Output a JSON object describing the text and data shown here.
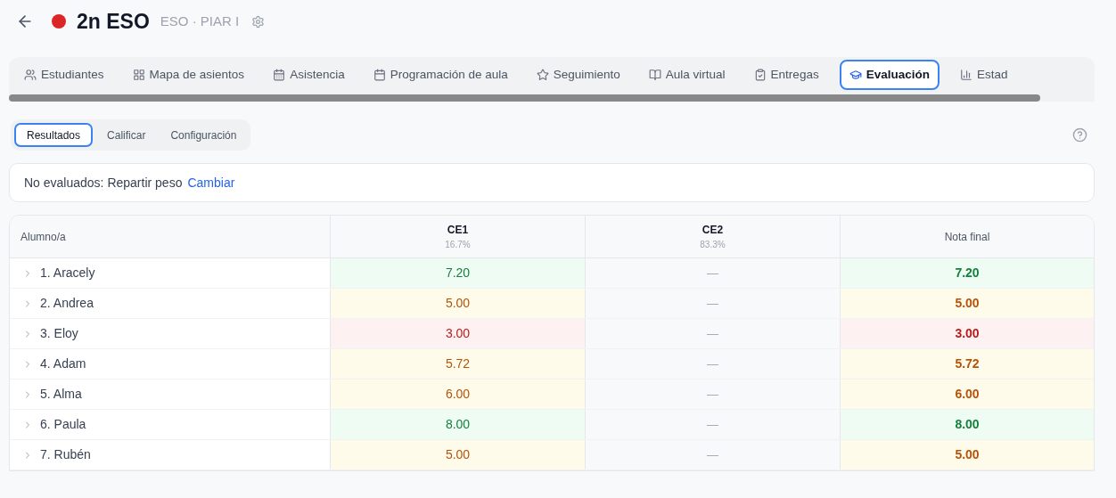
{
  "header": {
    "title": "2n ESO",
    "color": "#dc2626",
    "subtitle": "ESO · PIAR I"
  },
  "tabs": [
    {
      "label": "Estudiantes",
      "kind": "students",
      "selected": false
    },
    {
      "label": "Mapa de asientos",
      "kind": "seats",
      "selected": false
    },
    {
      "label": "Asistencia",
      "kind": "attendance",
      "selected": false
    },
    {
      "label": "Programación de aula",
      "kind": "planning",
      "selected": false
    },
    {
      "label": "Seguimiento",
      "kind": "tracking",
      "selected": false
    },
    {
      "label": "Aula virtual",
      "kind": "virtual",
      "selected": false
    },
    {
      "label": "Entregas",
      "kind": "submissions",
      "selected": false
    },
    {
      "label": "Evaluación",
      "kind": "evaluation",
      "selected": true
    },
    {
      "label": "Estad",
      "kind": "stats",
      "selected": false
    }
  ],
  "subtabs": [
    {
      "label": "Resultados",
      "selected": true
    },
    {
      "label": "Calificar",
      "selected": false
    },
    {
      "label": "Configuración",
      "selected": false
    }
  ],
  "notice": {
    "text": "No evaluados: Repartir peso",
    "link": "Cambiar"
  },
  "table": {
    "columns": [
      {
        "label": "Alumno/a"
      },
      {
        "label": "CE1",
        "weight": "16.7%"
      },
      {
        "label": "CE2",
        "weight": "83.3%"
      },
      {
        "label": "Nota final"
      }
    ],
    "rows": [
      {
        "name": "1. Aracely",
        "ce1": {
          "value": "7.20",
          "kind": "good"
        },
        "ce2": "—",
        "final": {
          "value": "7.20",
          "kind": "good"
        }
      },
      {
        "name": "2. Andrea",
        "ce1": {
          "value": "5.00",
          "kind": "mid"
        },
        "ce2": "—",
        "final": {
          "value": "5.00",
          "kind": "mid"
        }
      },
      {
        "name": "3. Eloy",
        "ce1": {
          "value": "3.00",
          "kind": "low"
        },
        "ce2": "—",
        "final": {
          "value": "3.00",
          "kind": "low"
        }
      },
      {
        "name": "4. Adam",
        "ce1": {
          "value": "5.72",
          "kind": "mid"
        },
        "ce2": "—",
        "final": {
          "value": "5.72",
          "kind": "mid"
        }
      },
      {
        "name": "5. Alma",
        "ce1": {
          "value": "6.00",
          "kind": "mid"
        },
        "ce2": "—",
        "final": {
          "value": "6.00",
          "kind": "mid"
        }
      },
      {
        "name": "6. Paula",
        "ce1": {
          "value": "8.00",
          "kind": "good"
        },
        "ce2": "—",
        "final": {
          "value": "8.00",
          "kind": "good"
        }
      },
      {
        "name": "7. Rubén",
        "ce1": {
          "value": "5.00",
          "kind": "mid"
        },
        "ce2": "—",
        "final": {
          "value": "5.00",
          "kind": "mid"
        }
      }
    ]
  }
}
